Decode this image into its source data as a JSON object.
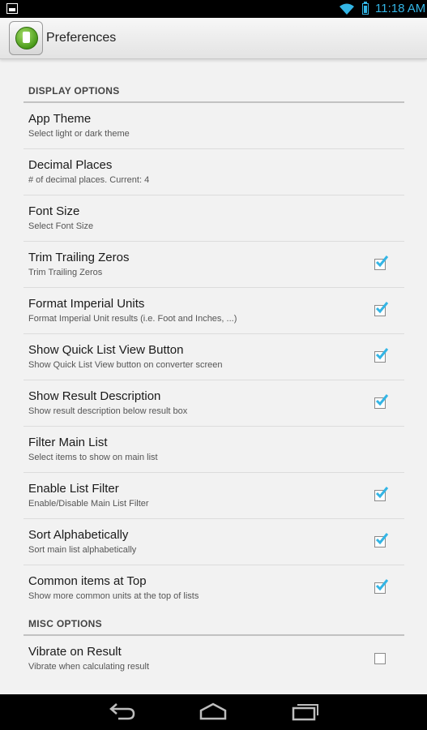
{
  "status_bar": {
    "time": "11:18 AM",
    "icons": [
      "notification-icon",
      "wifi-icon",
      "battery-icon"
    ],
    "accent_color": "#33b5e5"
  },
  "action_bar": {
    "title": "Preferences",
    "app_icon": "app-icon"
  },
  "sections": {
    "display": {
      "header": "DISPLAY OPTIONS",
      "items": [
        {
          "title": "App Theme",
          "summary": "Select light or dark theme",
          "has_checkbox": false
        },
        {
          "title": "Decimal Places",
          "summary": "# of decimal places.  Current: 4",
          "has_checkbox": false
        },
        {
          "title": "Font Size",
          "summary": "Select Font Size",
          "has_checkbox": false
        },
        {
          "title": "Trim Trailing Zeros",
          "summary": "Trim Trailing Zeros",
          "has_checkbox": true,
          "checked": true
        },
        {
          "title": "Format Imperial Units",
          "summary": "Format Imperial Unit results (i.e. Foot and Inches, ...)",
          "has_checkbox": true,
          "checked": true
        },
        {
          "title": "Show Quick List View Button",
          "summary": "Show Quick List View button on converter screen",
          "has_checkbox": true,
          "checked": true
        },
        {
          "title": "Show Result Description",
          "summary": "Show result description below result box",
          "has_checkbox": true,
          "checked": true
        },
        {
          "title": "Filter Main List",
          "summary": "Select items to show on main list",
          "has_checkbox": false
        },
        {
          "title": "Enable List Filter",
          "summary": "Enable/Disable Main List Filter",
          "has_checkbox": true,
          "checked": true
        },
        {
          "title": "Sort Alphabetically",
          "summary": "Sort main list alphabetically",
          "has_checkbox": true,
          "checked": true
        },
        {
          "title": "Common items at Top",
          "summary": "Show more common units at the top of lists",
          "has_checkbox": true,
          "checked": true
        }
      ]
    },
    "misc": {
      "header": "MISC OPTIONS",
      "items": [
        {
          "title": "Vibrate on Result",
          "summary": "Vibrate when calculating result",
          "has_checkbox": true,
          "checked": false
        }
      ]
    }
  },
  "nav_bar": {
    "buttons": [
      "back-icon",
      "home-icon",
      "recent-apps-icon"
    ]
  },
  "colors": {
    "check_color": "#33b5e5",
    "background": "#f2f2f2"
  }
}
